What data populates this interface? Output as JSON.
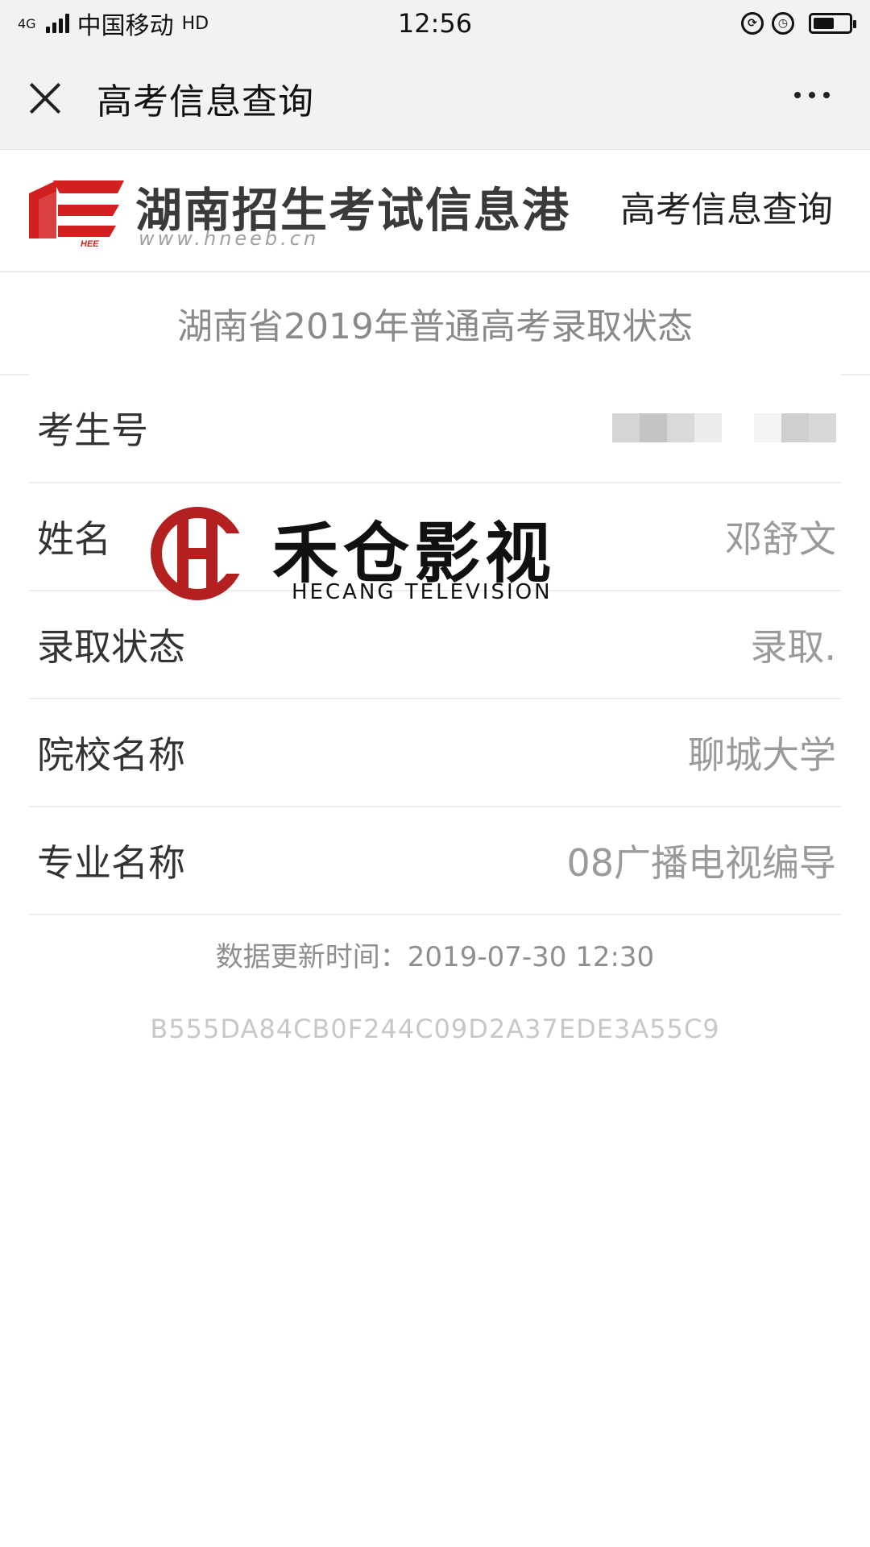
{
  "status_bar": {
    "network_small": "4G",
    "carrier": "中国移动",
    "hd": "HD",
    "time": "12:56",
    "battery_level": 0.6
  },
  "nav": {
    "title": "高考信息查询",
    "close_icon": "close-icon",
    "more_icon": "more-icon"
  },
  "header": {
    "logo_text": "HEE",
    "site_name": "湖南招生考试信息港",
    "site_url": "www.hneeb.cn",
    "right_title": "高考信息查询"
  },
  "section_title": "湖南省2019年普通高考录取状态",
  "rows": [
    {
      "label": "考生号",
      "value": ""
    },
    {
      "label": "姓名",
      "value": "邓舒文"
    },
    {
      "label": "录取状态",
      "value": "录取."
    },
    {
      "label": "院校名称",
      "value": "聊城大学"
    },
    {
      "label": "专业名称",
      "value": "08广播电视编导"
    }
  ],
  "footer": {
    "update_time": "数据更新时间：2019-07-30 12:30",
    "hash": "B555DA84CB0F244C09D2A37EDE3A55C9"
  },
  "watermark": {
    "cn": "禾仓影视",
    "en": "HECANG TELEVISION"
  },
  "colors": {
    "accent_red": "#d21f1f",
    "watermark_red": "#b3201f",
    "label": "#333333",
    "value": "#9a9a9a",
    "muted": "#c8c8c8"
  }
}
